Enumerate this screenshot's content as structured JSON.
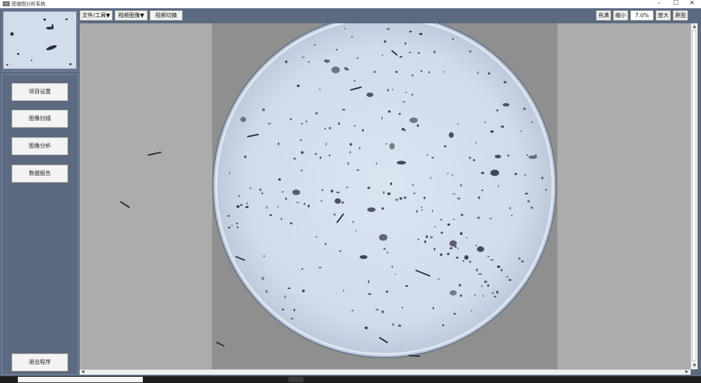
{
  "window": {
    "title": "图谱图分析系统",
    "minimize_symbol": "–",
    "maximize_symbol": "☐",
    "close_symbol": "✕"
  },
  "toolbar": {
    "file_tools": "文件/工具▼",
    "video_image": "视频图像▼",
    "video_switch": "视频切换",
    "fill_label": "充满",
    "zoom_out_label": "缩小",
    "zoom_value": "7.0%",
    "zoom_in_label": "放大",
    "original_label": "原图"
  },
  "sidebar": {
    "items": [
      {
        "label": "项目设置"
      },
      {
        "label": "图像扫描"
      },
      {
        "label": "图像分析"
      },
      {
        "label": "数据报告"
      }
    ],
    "exit_label": "退出程序"
  },
  "icons": {
    "app": "app-icon",
    "scroll_up": "arrow-up-icon",
    "scroll_down": "arrow-down-icon",
    "scroll_left": "arrow-left-icon",
    "scroll_right": "arrow-right-icon"
  },
  "colors": {
    "panel_bg": "#5b6a80",
    "viewer_side": "#acacac",
    "viewer_center": "#8f8f8f",
    "dish_fill": "#d0dbeb",
    "particle": "#2a2f38"
  }
}
